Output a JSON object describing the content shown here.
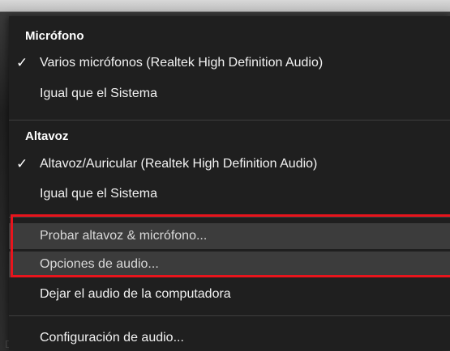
{
  "menu": {
    "microphone": {
      "header": "Micrófono",
      "items": [
        {
          "label": "Varios micrófonos (Realtek High Definition Audio)",
          "checked": "✓"
        },
        {
          "label": "Igual que el Sistema",
          "checked": ""
        }
      ]
    },
    "speaker": {
      "header": "Altavoz",
      "items": [
        {
          "label": "Altavoz/Auricular (Realtek High Definition Audio)",
          "checked": "✓"
        },
        {
          "label": "Igual que el Sistema",
          "checked": ""
        }
      ]
    },
    "actions": {
      "test_label": "Probar altavoz & micrófono...",
      "options_label": "Opciones de audio...",
      "leave_label": "Dejar el audio de la computadora",
      "settings_label": "Configuración de audio..."
    }
  },
  "highlight_color": "#e8141c"
}
